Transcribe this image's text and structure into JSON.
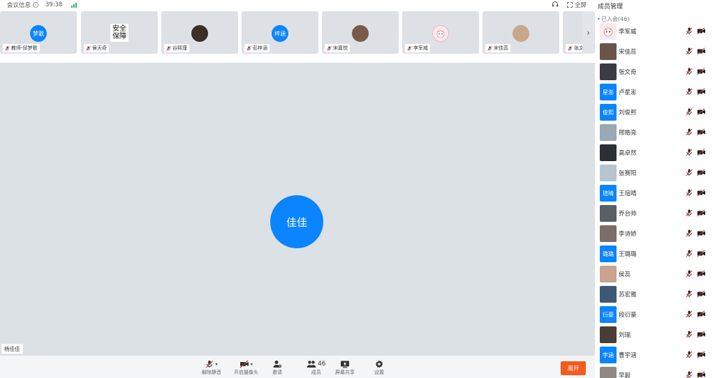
{
  "topbar": {
    "meeting_info": "会议信息",
    "info_glyph": "i",
    "timer": "39:38",
    "fullscreen": "全屏"
  },
  "thumbnails": [
    {
      "avatar_text": "梦歌",
      "name": "教师-邱梦歌",
      "avatar_type": "initials"
    },
    {
      "avatar_text_line1": "安全",
      "avatar_text_line2": "保障",
      "name": "侯天奇",
      "avatar_type": "text"
    },
    {
      "name": "谷熙瑾",
      "avatar_type": "photo"
    },
    {
      "avatar_text": "梓涵",
      "name": "彭梓涵",
      "avatar_type": "initials"
    },
    {
      "name": "宋嘉悦",
      "avatar_type": "photo"
    },
    {
      "name": "李军威",
      "avatar_type": "cartoon"
    },
    {
      "name": "宋佳蕊",
      "avatar_type": "photo"
    },
    {
      "name": "张文奇",
      "avatar_type": "partial"
    }
  ],
  "stage": {
    "avatar_text": "佳佳",
    "speaker_name": "杨佳佳"
  },
  "toolbar": {
    "unmute": "解除静音",
    "camera": "开启摄像头",
    "invite": "邀请",
    "members": "成员",
    "member_count": "46",
    "share": "屏幕共享",
    "settings": "设置",
    "leave": "离开"
  },
  "panel": {
    "title": "成员管理",
    "group_label": "已入会(46)",
    "members": [
      {
        "name": "李军威",
        "avatar_type": "cartoon"
      },
      {
        "name": "宋佳蕊",
        "avatar_type": "photo"
      },
      {
        "name": "张文奇",
        "avatar_type": "photo"
      },
      {
        "name": "卢星澎",
        "avatar_text": "星澎",
        "avatar_type": "initials"
      },
      {
        "name": "刘俊熙",
        "avatar_text": "俊熙",
        "avatar_type": "initials"
      },
      {
        "name": "邢皓亮",
        "avatar_type": "photo"
      },
      {
        "name": "高卓然",
        "avatar_type": "photo"
      },
      {
        "name": "张赛阳",
        "avatar_type": "photo"
      },
      {
        "name": "王瑄晴",
        "avatar_text": "瑄晴",
        "avatar_type": "initials"
      },
      {
        "name": "乔台帅",
        "avatar_type": "photo"
      },
      {
        "name": "李诗娇",
        "avatar_type": "photo"
      },
      {
        "name": "王璐璐",
        "avatar_text": "璐璐",
        "avatar_type": "initials"
      },
      {
        "name": "侯蕊",
        "avatar_type": "photo"
      },
      {
        "name": "苏宏雅",
        "avatar_type": "photo"
      },
      {
        "name": "段衍豪",
        "avatar_text": "衍豪",
        "avatar_type": "initials"
      },
      {
        "name": "刘瑞",
        "avatar_type": "photo"
      },
      {
        "name": "曹宇涵",
        "avatar_text": "宇涵",
        "avatar_type": "initials"
      },
      {
        "name": "早毅",
        "avatar_type": "photo"
      }
    ]
  },
  "colors": {
    "accent": "#0a84ff",
    "leave": "#f55a1e",
    "stage_bg": "#dce1e6",
    "signal": "#2fb85c",
    "muted_icon": "#c0392b"
  },
  "icons": {
    "mic_muted": "mic-muted-icon",
    "camera_off": "camera-off-icon",
    "invite": "invite-icon",
    "members": "members-icon",
    "share": "share-screen-icon",
    "settings": "gear-icon"
  }
}
